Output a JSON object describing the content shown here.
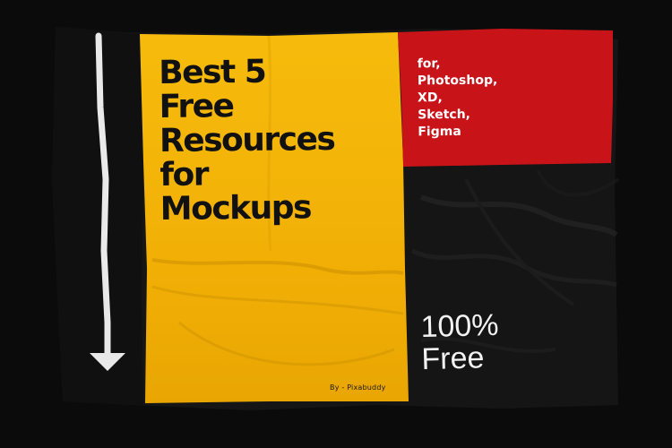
{
  "headline_lines": [
    "Best 5",
    "Free",
    "Resources",
    "for",
    "Mockups"
  ],
  "tools_lines": [
    "for,",
    "Photoshop,",
    "XD,",
    "Sketch,",
    "Figma"
  ],
  "free_lines": [
    "100%",
    "Free"
  ],
  "credit": "By - Pixabuddy",
  "colors": {
    "background": "#0b0b0b",
    "flag_black": "#151515",
    "panel_yellow": "#f3b307",
    "panel_red": "#c81318",
    "arrow": "#e9e9e9"
  },
  "icons": {
    "arrow": "down-arrow-icon"
  }
}
